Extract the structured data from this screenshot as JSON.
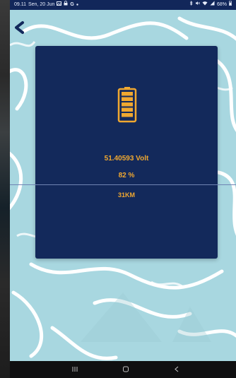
{
  "status_bar": {
    "time": "09.11",
    "date": "Sen, 20 Jun",
    "notification_icons": [
      "gallery-icon",
      "lock-icon",
      "google-icon",
      "dot-icon"
    ],
    "system_icons": [
      "bluetooth-icon",
      "mute-icon",
      "wifi-icon",
      "signal-icon"
    ],
    "battery_level": "68%"
  },
  "back_button": {
    "icon": "chevron-left-icon"
  },
  "battery_card": {
    "icon": "battery-full-icon",
    "voltage": "51.40593 Volt",
    "percentage": "82 %",
    "distance": "31KM"
  },
  "navigation_bar": {
    "recents_icon": "recents-icon",
    "home_icon": "home-icon",
    "back_icon": "back-icon"
  },
  "colors": {
    "background": "#a8d7e0",
    "card": "#13295b",
    "accent": "#f0a830",
    "status_bar": "#12275a",
    "nav_bar": "#0f0f10"
  }
}
